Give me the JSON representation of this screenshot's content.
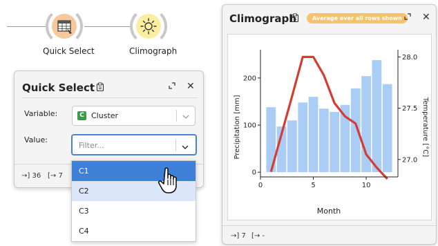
{
  "canvas": {
    "nodes": [
      {
        "label": "Quick Select",
        "icon": "quick-select-icon"
      },
      {
        "label": "Climograph",
        "icon": "sun-icon"
      }
    ]
  },
  "quick_select": {
    "title": "Quick Select",
    "variable_label": "Variable:",
    "variable_value": "Cluster",
    "variable_badge": "C",
    "value_label": "Value:",
    "value_placeholder": "Filter...",
    "options": [
      "C1",
      "C2",
      "C3",
      "C4"
    ],
    "selected_option": "C1",
    "hovered_option": "C2",
    "status_in": "36",
    "status_out": "7"
  },
  "climograph": {
    "title": "Climograph",
    "badge": "Average over all rows shown",
    "status_in": "7",
    "status_out": "-"
  },
  "colors": {
    "bar": "#aacdf5",
    "line": "#d63b2f",
    "accent": "#4a83d6",
    "badge": "#f5c36b",
    "cluster_green": "#3b9b47"
  },
  "chart_data": {
    "type": "bar+line",
    "xlabel": "Month",
    "ylabel_left": "Precipitation [mm]",
    "ylabel_right": "Temperature [°C]",
    "x_ticks": [
      0,
      5,
      10
    ],
    "y_left_ticks": [
      0,
      100,
      200
    ],
    "y_right_ticks": [
      "27.0",
      "27.5",
      "28.0"
    ],
    "xlim": [
      0,
      13
    ],
    "ylim_left": [
      -10,
      260
    ],
    "ylim_right": [
      26.83,
      28.07
    ],
    "series": [
      {
        "kind": "bar",
        "x": [
          1,
          2,
          3,
          4,
          5,
          6,
          7,
          8,
          9,
          10,
          11,
          12
        ],
        "values": [
          138,
          97,
          110,
          148,
          160,
          135,
          128,
          143,
          178,
          204,
          238,
          187
        ]
      },
      {
        "kind": "line",
        "x": [
          1,
          2,
          3,
          4,
          5,
          6,
          7,
          8,
          9,
          10,
          11,
          12
        ],
        "values": [
          26.88,
          27.25,
          27.62,
          28.0,
          28.0,
          27.82,
          27.55,
          27.42,
          27.35,
          27.05,
          26.92,
          26.81
        ]
      }
    ]
  }
}
